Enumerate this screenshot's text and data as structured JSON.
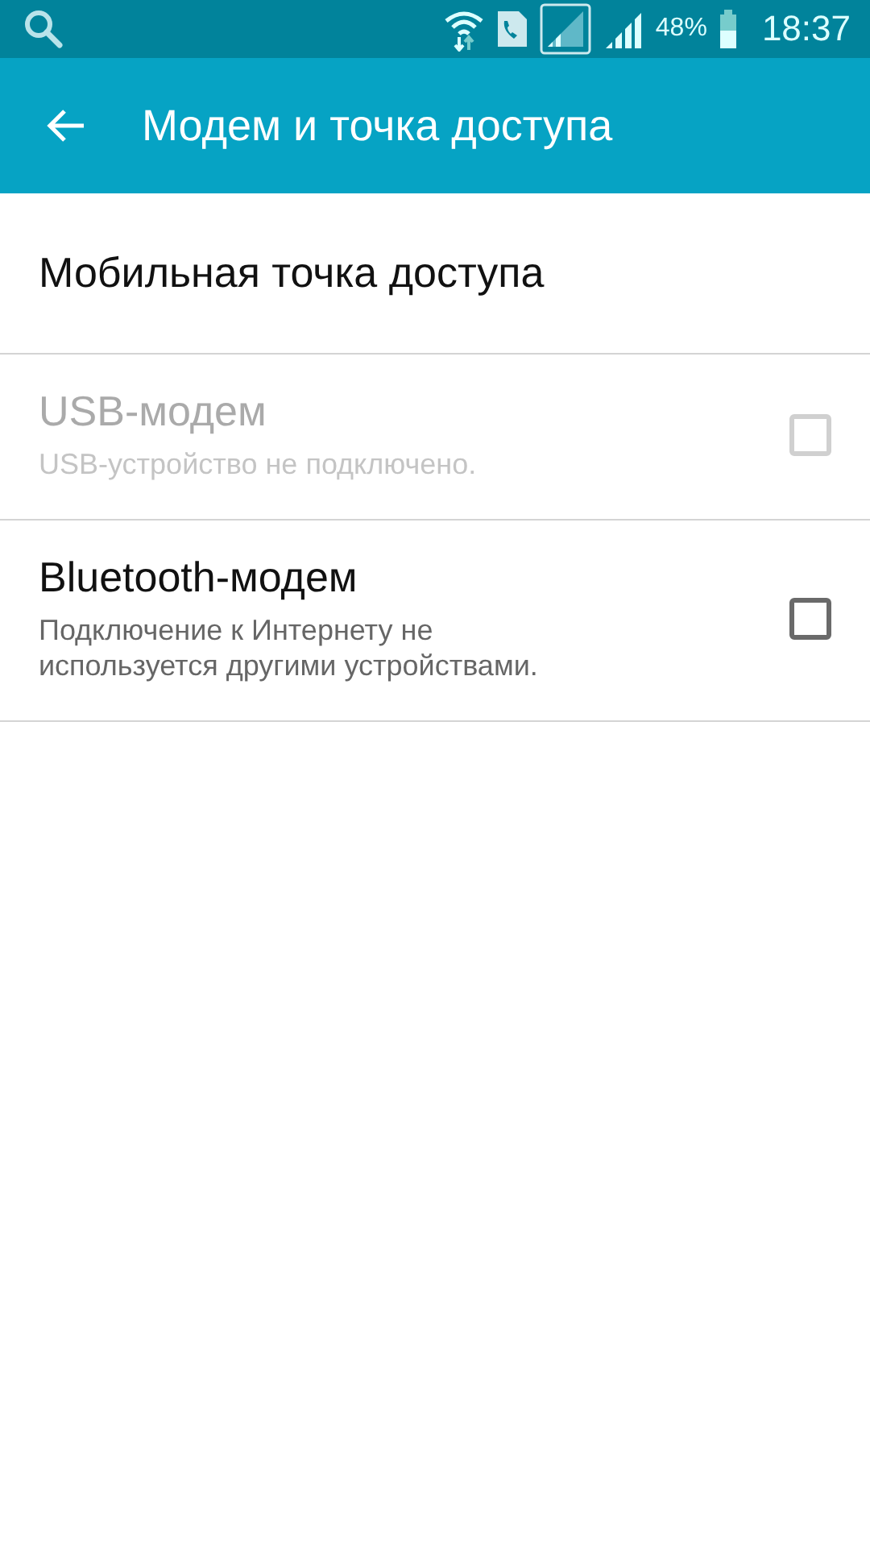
{
  "status_bar": {
    "battery_text": "48%",
    "time": "18:37"
  },
  "app_bar": {
    "title": "Модем и точка доступа"
  },
  "items": [
    {
      "kind": "plain",
      "title": "Мобильная точка доступа"
    },
    {
      "kind": "checkbox",
      "title": "USB-модем",
      "subtitle": "USB-устройство не подключено.",
      "disabled": true,
      "checked": false
    },
    {
      "kind": "checkbox",
      "title": "Bluetooth-модем",
      "subtitle": "Подключение к Интернету не используется другими устройствами.",
      "disabled": false,
      "checked": false
    }
  ]
}
